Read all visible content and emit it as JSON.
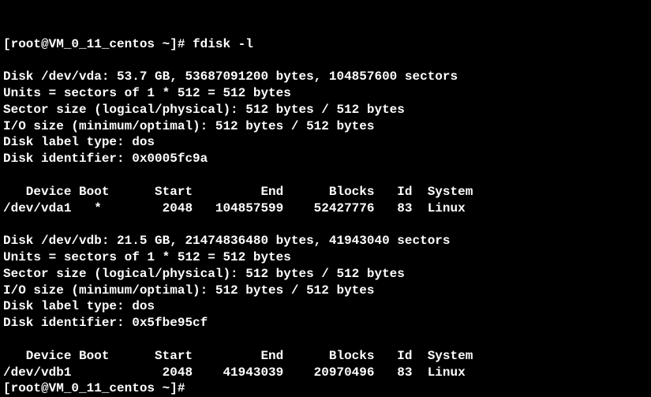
{
  "prompt1": "[root@VM_0_11_centos ~]# ",
  "command": "fdisk -l",
  "disk1": {
    "header": "Disk /dev/vda: 53.7 GB, 53687091200 bytes, 104857600 sectors",
    "units": "Units = sectors of 1 * 512 = 512 bytes",
    "sector_size": "Sector size (logical/physical): 512 bytes / 512 bytes",
    "io_size": "I/O size (minimum/optimal): 512 bytes / 512 bytes",
    "label_type": "Disk label type: dos",
    "identifier": "Disk identifier: 0x0005fc9a",
    "table_header": "   Device Boot      Start         End      Blocks   Id  System",
    "partition": "/dev/vda1   *        2048   104857599    52427776   83  Linux"
  },
  "disk2": {
    "header": "Disk /dev/vdb: 21.5 GB, 21474836480 bytes, 41943040 sectors",
    "units": "Units = sectors of 1 * 512 = 512 bytes",
    "sector_size": "Sector size (logical/physical): 512 bytes / 512 bytes",
    "io_size": "I/O size (minimum/optimal): 512 bytes / 512 bytes",
    "label_type": "Disk label type: dos",
    "identifier": "Disk identifier: 0x5fbe95cf",
    "table_header": "   Device Boot      Start         End      Blocks   Id  System",
    "partition": "/dev/vdb1            2048    41943039    20970496   83  Linux"
  },
  "prompt2": "[root@VM_0_11_centos ~]# "
}
